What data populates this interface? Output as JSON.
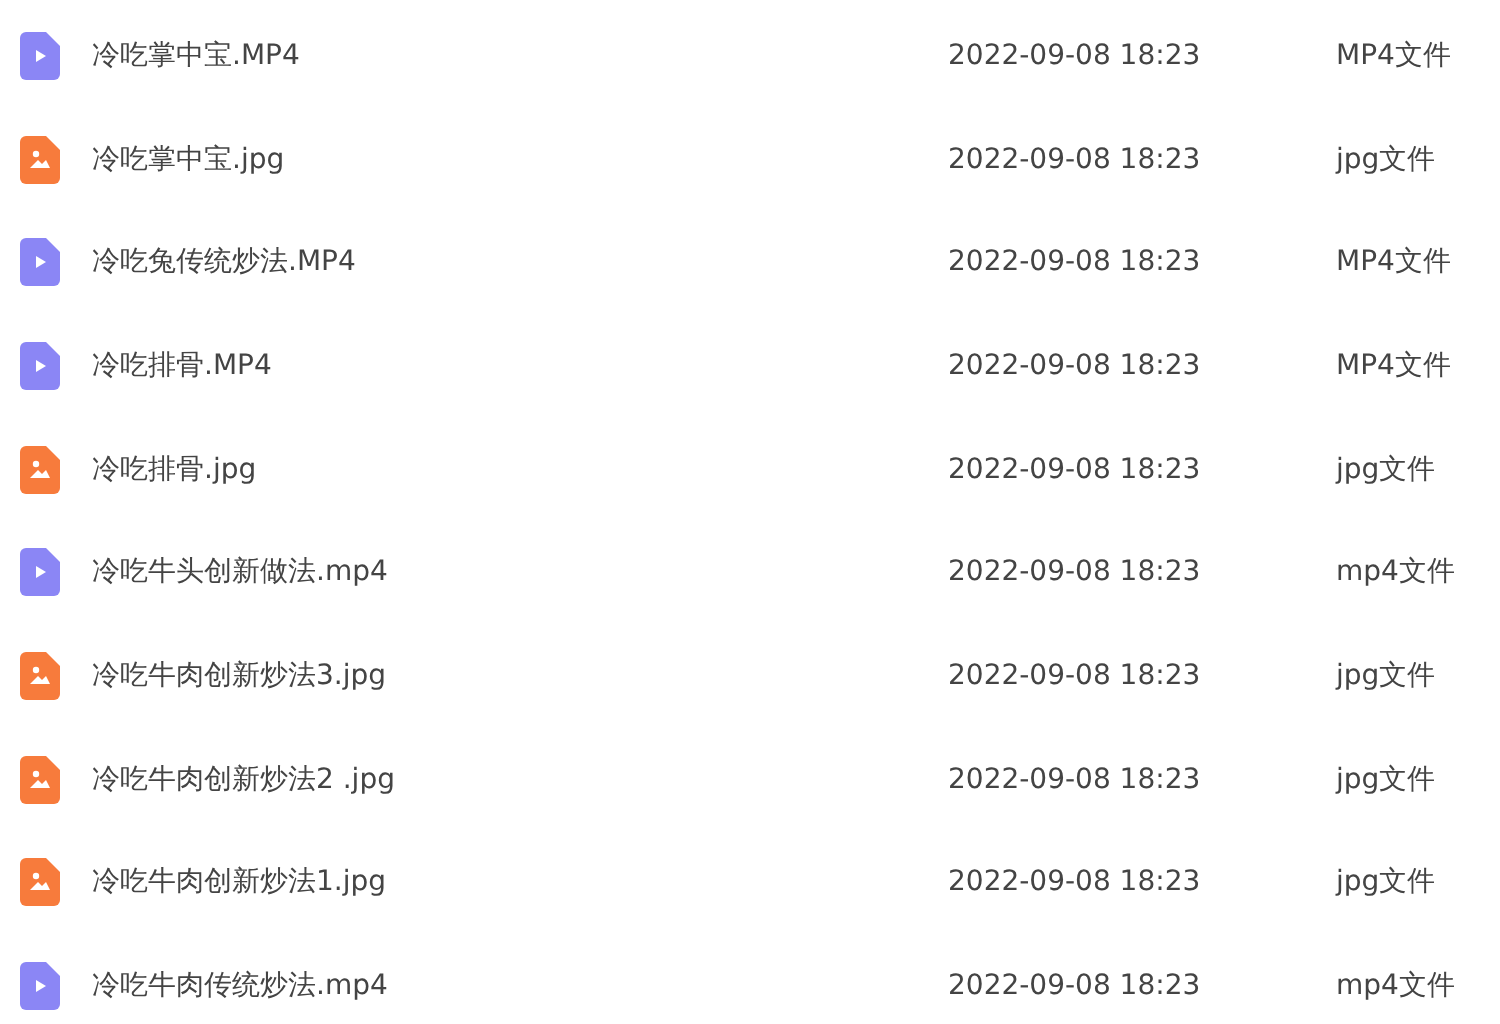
{
  "files": [
    {
      "kind": "video",
      "name": "冷吃掌中宝.MP4",
      "modified": "2022-09-08 18:23",
      "type": "MP4文件"
    },
    {
      "kind": "image",
      "name": "冷吃掌中宝.jpg",
      "modified": "2022-09-08 18:23",
      "type": "jpg文件"
    },
    {
      "kind": "video",
      "name": "冷吃兔传统炒法.MP4",
      "modified": "2022-09-08 18:23",
      "type": "MP4文件"
    },
    {
      "kind": "video",
      "name": "冷吃排骨.MP4",
      "modified": "2022-09-08 18:23",
      "type": "MP4文件"
    },
    {
      "kind": "image",
      "name": "冷吃排骨.jpg",
      "modified": "2022-09-08 18:23",
      "type": "jpg文件"
    },
    {
      "kind": "video",
      "name": "冷吃牛头创新做法.mp4",
      "modified": "2022-09-08 18:23",
      "type": "mp4文件"
    },
    {
      "kind": "image",
      "name": "冷吃牛肉创新炒法3.jpg",
      "modified": "2022-09-08 18:23",
      "type": "jpg文件"
    },
    {
      "kind": "image",
      "name": "冷吃牛肉创新炒法2 .jpg",
      "modified": "2022-09-08 18:23",
      "type": "jpg文件"
    },
    {
      "kind": "image",
      "name": "冷吃牛肉创新炒法1.jpg",
      "modified": "2022-09-08 18:23",
      "type": "jpg文件"
    },
    {
      "kind": "video",
      "name": "冷吃牛肉传统炒法.mp4",
      "modified": "2022-09-08 18:23",
      "type": "mp4文件"
    }
  ]
}
